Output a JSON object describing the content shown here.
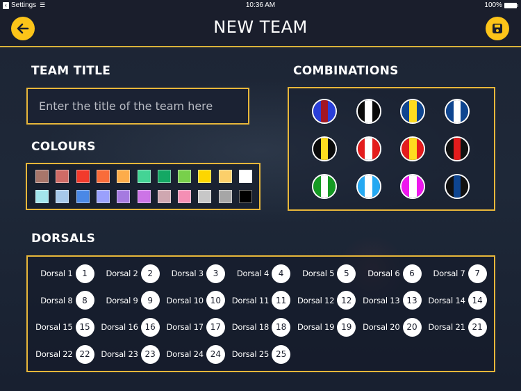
{
  "status_bar": {
    "back_app": "Settings",
    "time": "10:36 AM",
    "battery": "100%"
  },
  "header": {
    "title": "NEW TEAM",
    "back_icon": "arrow-left-icon",
    "save_icon": "floppy-disk-icon"
  },
  "team_title": {
    "label": "TEAM TITLE",
    "value": "",
    "placeholder": "Enter the title of the team here"
  },
  "colours": {
    "label": "COLOURS",
    "rows": [
      [
        "#a8766a",
        "#cf6b66",
        "#f23a2c",
        "#f96c3a",
        "#fdac4a",
        "#44d495",
        "#14a864",
        "#78d04b",
        "#fdd600",
        "#fbcf6a",
        "#ffffff"
      ],
      [
        "#a3e5ec",
        "#a6c8ea",
        "#4a88e6",
        "#9aa0fc",
        "#a57ae0",
        "#cc74e6",
        "#cfa7b0",
        "#f48fb4",
        "#c7c7c7",
        "#a6a6a6",
        "#000000"
      ]
    ]
  },
  "combinations": {
    "label": "COMBINATIONS",
    "items": [
      {
        "stripes": [
          "#2a3fd8",
          "#a31622",
          "#2a3fd8"
        ]
      },
      {
        "stripes": [
          "#0a0a0a",
          "#ffffff",
          "#0a0a0a"
        ]
      },
      {
        "stripes": [
          "#0e4590",
          "#fedc1f",
          "#0e4590"
        ]
      },
      {
        "stripes": [
          "#0e4590",
          "#ffffff",
          "#0e4590"
        ]
      },
      {
        "stripes": [
          "#0a0a0a",
          "#fedc1f",
          "#0a0a0a"
        ]
      },
      {
        "stripes": [
          "#e41c1c",
          "#ffffff",
          "#e41c1c"
        ]
      },
      {
        "stripes": [
          "#e41c1c",
          "#fedc1f",
          "#e41c1c"
        ]
      },
      {
        "stripes": [
          "#111111",
          "#e41c1c",
          "#111111"
        ]
      },
      {
        "stripes": [
          "#159a23",
          "#ffffff",
          "#159a23"
        ]
      },
      {
        "stripes": [
          "#25a9f2",
          "#ffffff",
          "#25a9f2"
        ]
      },
      {
        "stripes": [
          "#ee17ee",
          "#ffffff",
          "#ee17ee"
        ]
      },
      {
        "stripes": [
          "#111111",
          "#0e4590",
          "#111111"
        ]
      }
    ]
  },
  "dorsals": {
    "label": "DORSALS",
    "items": [
      {
        "label": "Dorsal 1",
        "number": "1"
      },
      {
        "label": "Dorsal 2",
        "number": "2"
      },
      {
        "label": "Dorsal 3",
        "number": "3"
      },
      {
        "label": "Dorsal 4",
        "number": "4"
      },
      {
        "label": "Dorsal 5",
        "number": "5"
      },
      {
        "label": "Dorsal 6",
        "number": "6"
      },
      {
        "label": "Dorsal 7",
        "number": "7"
      },
      {
        "label": "Dorsal 8",
        "number": "8"
      },
      {
        "label": "Dorsal 9",
        "number": "9"
      },
      {
        "label": "Dorsal 10",
        "number": "10"
      },
      {
        "label": "Dorsal 11",
        "number": "11"
      },
      {
        "label": "Dorsal 12",
        "number": "12"
      },
      {
        "label": "Dorsal 13",
        "number": "13"
      },
      {
        "label": "Dorsal 14",
        "number": "14"
      },
      {
        "label": "Dorsal 15",
        "number": "15"
      },
      {
        "label": "Dorsal 16",
        "number": "16"
      },
      {
        "label": "Dorsal 17",
        "number": "17"
      },
      {
        "label": "Dorsal 18",
        "number": "18"
      },
      {
        "label": "Dorsal 19",
        "number": "19"
      },
      {
        "label": "Dorsal 20",
        "number": "20"
      },
      {
        "label": "Dorsal 21",
        "number": "21"
      },
      {
        "label": "Dorsal 22",
        "number": "22"
      },
      {
        "label": "Dorsal 23",
        "number": "23"
      },
      {
        "label": "Dorsal 24",
        "number": "24"
      },
      {
        "label": "Dorsal 25",
        "number": "25"
      }
    ]
  },
  "theme": {
    "accent": "#fcc419",
    "border_gold": "#e8b73a",
    "background": "#1a2030"
  }
}
